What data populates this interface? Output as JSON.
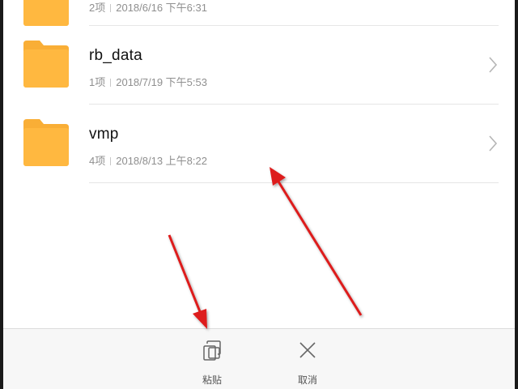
{
  "folders": [
    {
      "name": "",
      "count": "2项",
      "date": "2018/6/16 下午6:31"
    },
    {
      "name": "rb_data",
      "count": "1项",
      "date": "2018/7/19 下午5:53"
    },
    {
      "name": "vmp",
      "count": "4项",
      "date": "2018/8/13 上午8:22"
    }
  ],
  "toolbar": {
    "paste_label": "粘贴",
    "cancel_label": "取消"
  },
  "colors": {
    "folder": "#FFB840",
    "folder_tab": "#F9AE36",
    "annotation_arrow": "#DD1A1A"
  },
  "icons": {
    "folder": "folder-icon",
    "chevron": "chevron-right-icon",
    "paste": "paste-icon",
    "cancel": "close-icon"
  }
}
